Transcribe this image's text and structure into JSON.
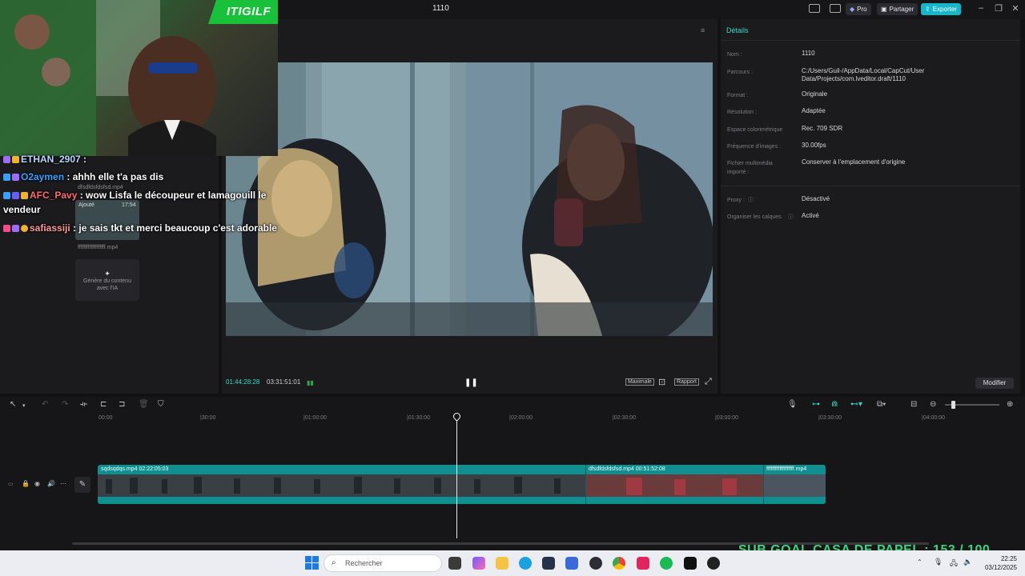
{
  "window": {
    "title": "1110"
  },
  "topbar": {
    "pro_label": "Pro",
    "share_label": "Partager",
    "export_label": "Exporter"
  },
  "media": {
    "clip1_name": "dfsdfdsfdsfsd.mp4",
    "added_label": "Ajouté",
    "clip2_duration": "17:54",
    "clip2_name": "fffffffffffffffffff.mp4",
    "ai_card_label": "Génère du contenu avec l'IA"
  },
  "player": {
    "current_time": "01:44:28:28",
    "total_time": "03:31:51:01",
    "max_label": "Maximale",
    "ratio_label": "Rapport"
  },
  "details": {
    "title": "Détails",
    "rows": [
      {
        "label": "Nom :",
        "value": "1110"
      },
      {
        "label": "Parcours :",
        "value": "C:/Users/Guil-/AppData/Local/CapCut/User Data/Projects/com.lveditor.draft/1110"
      },
      {
        "label": "Format :",
        "value": "Originale"
      },
      {
        "label": "Résolution :",
        "value": "Adaptée"
      },
      {
        "label": "Espace colorimétrique",
        "value": "Rec. 709 SDR"
      },
      {
        "label": "Fréquence d'images :",
        "value": "30.00fps"
      },
      {
        "label": "Fichier multimédia importé :",
        "value": "Conserver à l'emplacement d'origine"
      },
      {
        "label": "Proxy :",
        "value": "Désactivé"
      },
      {
        "label": "Organiser les calques",
        "value": "Activé"
      }
    ],
    "modify_label": "Modifier"
  },
  "timeline": {
    "ruler": [
      "00:00",
      "|30:00",
      "|01:00:00",
      "|01:30:00",
      "|02:00:00",
      "|02:30:00",
      "|03:00:00",
      "|03:30:00",
      "|04:00:00"
    ],
    "clips": [
      {
        "header": "sqdsqdqs.mp4   02:22:05:03"
      },
      {
        "header": "dfsdfdsfdsfsd.mp4   00:51:52:08"
      },
      {
        "header": "fffffffffffffffffff.mp4"
      }
    ]
  },
  "overlay": {
    "webcam_tag": "ITIGILF",
    "chat": [
      {
        "user": "ETHAN_2907",
        "message": " :",
        "user_color": "#b8d8ff"
      },
      {
        "user": "O2aymen",
        "message": " : ahhh elle t'a pas dis",
        "user_color": "#3aa0ff"
      },
      {
        "user": "AFC_Pavy",
        "message": " : wow Lisfa le découpeur et lamagouill le vendeur",
        "user_color": "#ff6a6a"
      },
      {
        "user": "safiassiji",
        "message": " : je sais tkt et merci beaucoup c'est adorable",
        "user_color": "#ff9a9a"
      }
    ],
    "sub_goal": "SUB GOAL CASA DE PAPEL : 153 / 100"
  },
  "taskbar": {
    "search_placeholder": "Rechercher",
    "time": "22:25",
    "date": "03/12/2025"
  },
  "colors": {
    "accent": "#17b6c8",
    "teal_text": "#3ed8c8",
    "clip_track": "#0f8f8f"
  }
}
